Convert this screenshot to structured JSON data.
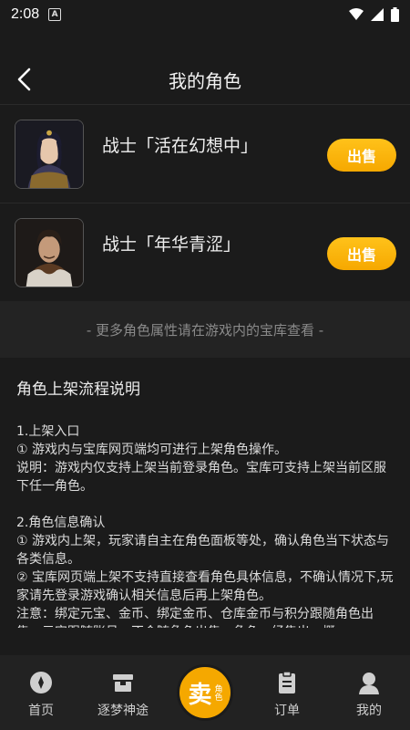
{
  "status": {
    "time": "2:08",
    "notif": "A"
  },
  "header": {
    "title": "我的角色"
  },
  "roles": [
    {
      "name": "战士「活在幻想中」",
      "sell_label": "出售"
    },
    {
      "name": "战士「年华青涩」",
      "sell_label": "出售"
    }
  ],
  "hint": "- 更多角色属性请在游戏内的宝库查看 -",
  "info": {
    "title": "角色上架流程说明",
    "lines": [
      "1.上架入口",
      "① 游戏内与宝库网页端均可进行上架角色操作。",
      "说明：游戏内仅支持上架当前登录角色。宝库可支持上架当前区服下任一角色。",
      "2.角色信息确认",
      "① 游戏内上架，玩家请自主在角色面板等处，确认角色当下状态与各类信息。",
      "② 宝库网页端上架不支持直接查看角色具体信息，不确认情况下,玩家请先登录游戏确认相关信息后再上架角色。",
      "注意：绑定元宝、金币、绑定金币、仓库金币与积分跟随角色出售，元宝跟随账号，不会随角色出售。角色一经售出，概"
    ]
  },
  "tabs": [
    {
      "label": "首页",
      "icon": "home-icon"
    },
    {
      "label": "逐梦神途",
      "icon": "game-icon"
    },
    {
      "label": "订单",
      "icon": "order-icon"
    },
    {
      "label": "我的",
      "icon": "profile-icon"
    }
  ],
  "center_tab": {
    "main": "卖",
    "sub": "角色"
  },
  "colors": {
    "accent": "#f6a800",
    "background": "#1b1b1b"
  }
}
